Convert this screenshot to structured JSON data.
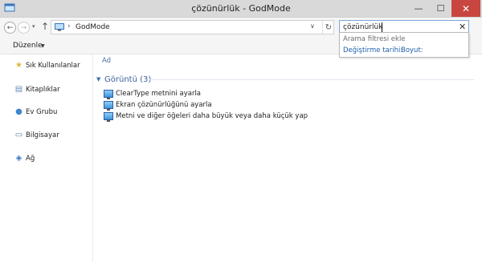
{
  "window": {
    "title": "çözünürlük - GodMode"
  },
  "controls": {
    "minimize": "—",
    "maximize": "☐",
    "close": "✕"
  },
  "nav": {
    "back": "←",
    "forward": "→",
    "recent": "▾",
    "up": "↑"
  },
  "address": {
    "separator": "›",
    "path": "GodMode",
    "dropdown": "∨",
    "refresh": "↻"
  },
  "search": {
    "value": "çözünürlük",
    "clear": "✕"
  },
  "suggestions": {
    "heading": "Arama filtresi ekle",
    "items": [
      "Değiştirme tarihi:",
      "Boyut:"
    ]
  },
  "toolbar": {
    "organize_label": "Düzenle",
    "organize_caret": "▼"
  },
  "navpane": {
    "items": [
      {
        "label": "Sık Kullanılanlar",
        "icon": "star-icon"
      },
      {
        "label": "Kitaplıklar",
        "icon": "library-icon"
      },
      {
        "label": "Ev Grubu",
        "icon": "homegroup-icon"
      },
      {
        "label": "Bilgisayar",
        "icon": "computer-icon"
      },
      {
        "label": "Ağ",
        "icon": "network-icon"
      }
    ]
  },
  "content": {
    "column_header": "Ad",
    "group": {
      "chevron": "▼",
      "label": "Görüntü (3)"
    },
    "files": [
      "ClearType metnini ayarla",
      "Ekran çözünürlüğünü ayarla",
      "Metni ve diğer öğeleri daha büyük veya daha küçük yap"
    ]
  },
  "colors": {
    "close": "#c7463f",
    "link": "#1f5fab",
    "group": "#3d5fa0"
  }
}
